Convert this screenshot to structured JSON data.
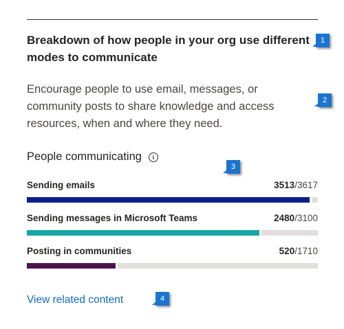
{
  "card": {
    "title": "Breakdown of how people in your org use different modes to communicate",
    "description": "Encourage people to use email, messages, or community posts to share knowledge and access resources, when and where they need."
  },
  "section": {
    "title": "People communicating",
    "info_icon": "info-icon"
  },
  "metrics": [
    {
      "label": "Sending emails",
      "value": "3513",
      "total": "/3617",
      "fraction": 0.971,
      "color": "#0c1e87"
    },
    {
      "label": "Sending messages in Microsoft Teams",
      "value": "2480",
      "total": "/3100",
      "fraction": 0.8,
      "color": "#14a6a6"
    },
    {
      "label": "Posting in communities",
      "value": "520",
      "total": "/1710",
      "fraction": 0.304,
      "color": "#4b1450"
    }
  ],
  "link": {
    "label": "View related content"
  },
  "callouts": [
    "1",
    "2",
    "3",
    "4"
  ],
  "colors": {
    "callout": "#1b75d0",
    "link": "#0f6cbd",
    "track": "#e1dfdd"
  }
}
